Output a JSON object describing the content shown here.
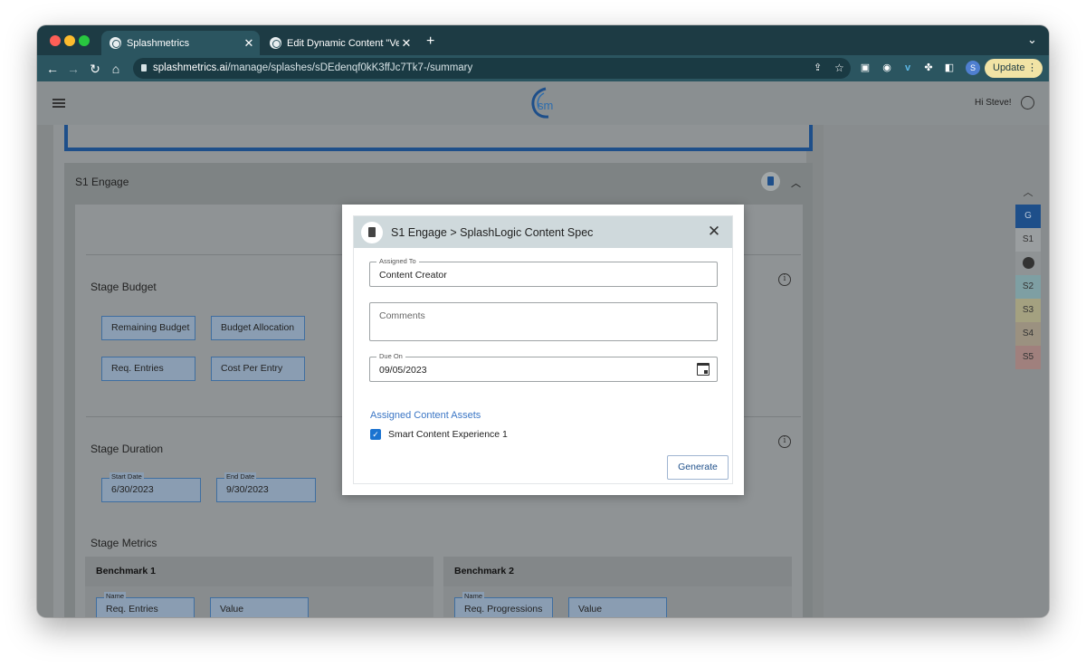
{
  "browser": {
    "tabs": [
      {
        "title": "Splashmetrics",
        "active": true
      },
      {
        "title": "Edit Dynamic Content \"Version",
        "active": false
      }
    ],
    "new_tab": "+",
    "tab_menu": "⌄",
    "address": {
      "host": "splashmetrics.ai",
      "path": "/manage/splashes/sDEdenqf0kK3ffJc7Tk7-/summary"
    },
    "profile_initial": "S",
    "update_label": "Update"
  },
  "header": {
    "logo_text": "sm",
    "greeting": "Hi Steve!"
  },
  "section": {
    "title": "S1 Engage",
    "stage_budget": {
      "title": "Stage Budget",
      "fields": [
        "Remaining Budget",
        "Budget Allocation",
        "Req. Entries",
        "Cost Per Entry"
      ]
    },
    "stage_duration": {
      "title": "Stage Duration",
      "start": {
        "label": "Start Date",
        "value": "6/30/2023"
      },
      "end": {
        "label": "End Date",
        "value": "9/30/2023"
      }
    },
    "stage_metrics": {
      "title": "Stage Metrics",
      "benchmarks": [
        {
          "title": "Benchmark 1",
          "name_label": "Name",
          "name": "Req. Entries",
          "value": "Value"
        },
        {
          "title": "Benchmark 2",
          "name_label": "Name",
          "name": "Req. Progressions",
          "value": "Value"
        }
      ]
    }
  },
  "stage_nav": [
    "G",
    "S1",
    "S2",
    "S3",
    "S4",
    "S5"
  ],
  "stage_nav_colors": {
    "G": "#1e4f8a",
    "S1": "#9a9ea0",
    "S2": "#7e9fa3",
    "S3": "#a4a180",
    "S4": "#9b9180",
    "S5": "#a0807d"
  },
  "modal": {
    "title": "S1 Engage > SplashLogic Content Spec",
    "assigned_to": {
      "label": "Assigned To",
      "value": "Content Creator"
    },
    "comments": {
      "placeholder": "Comments"
    },
    "due_on": {
      "label": "Due On",
      "value": "09/05/2023"
    },
    "assets_title": "Assigned Content Assets",
    "assets": [
      {
        "label": "Smart Content Experience 1",
        "checked": true
      }
    ],
    "generate_label": "Generate"
  },
  "colors": {
    "brand_dark": "#1d3b44",
    "accent_blue": "#1e4f8a",
    "link_blue": "#3b76c5",
    "checkbox_blue": "#1b73d0"
  }
}
